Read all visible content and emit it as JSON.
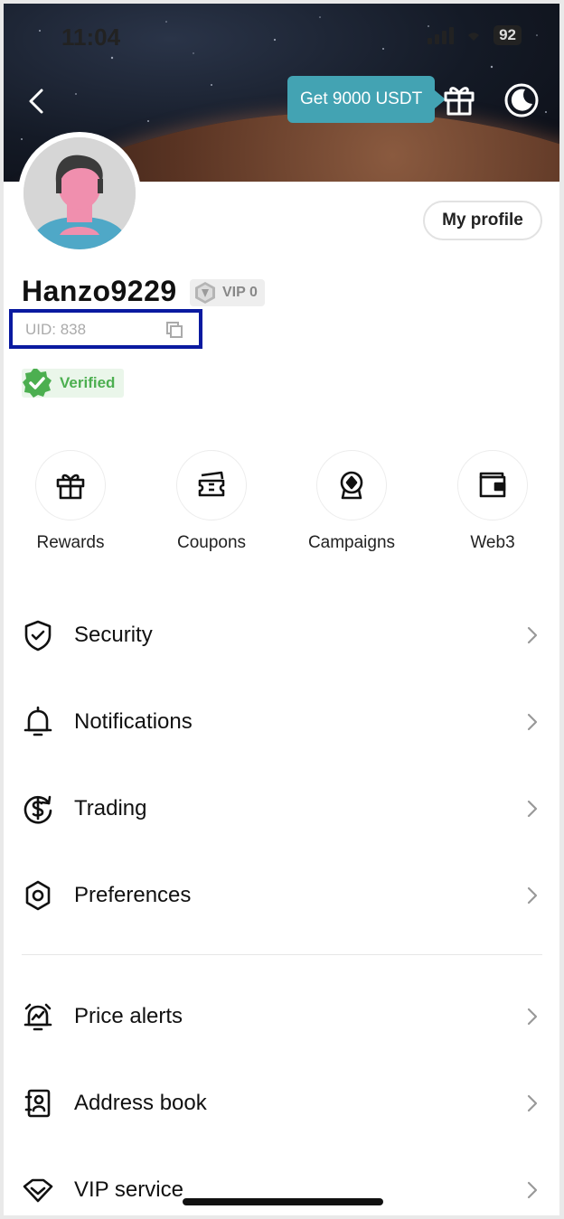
{
  "status_bar": {
    "time": "11:04",
    "battery": "92"
  },
  "header": {
    "promo_label": "Get 9000 USDT"
  },
  "profile": {
    "my_profile_label": "My profile",
    "username": "Hanzo9229",
    "vip_label": "VIP 0",
    "uid": "UID: 838",
    "verified_label": "Verified"
  },
  "shortcuts": [
    {
      "label": "Rewards",
      "icon": "gift-icon"
    },
    {
      "label": "Coupons",
      "icon": "ticket-icon"
    },
    {
      "label": "Campaigns",
      "icon": "award-icon"
    },
    {
      "label": "Web3",
      "icon": "wallet-icon"
    }
  ],
  "menu": [
    {
      "label": "Security",
      "icon": "shield-icon"
    },
    {
      "label": "Notifications",
      "icon": "bell-icon"
    },
    {
      "label": "Trading",
      "icon": "dollar-cycle-icon"
    },
    {
      "label": "Preferences",
      "icon": "hexagon-settings-icon"
    }
  ],
  "menu2": [
    {
      "label": "Price alerts",
      "icon": "alarm-icon"
    },
    {
      "label": "Address book",
      "icon": "contact-book-icon"
    },
    {
      "label": "VIP service",
      "icon": "diamond-icon"
    }
  ],
  "colors": {
    "accent": "#43a3b3",
    "verified": "#4caf50",
    "highlight_box": "#0a1aa0"
  }
}
